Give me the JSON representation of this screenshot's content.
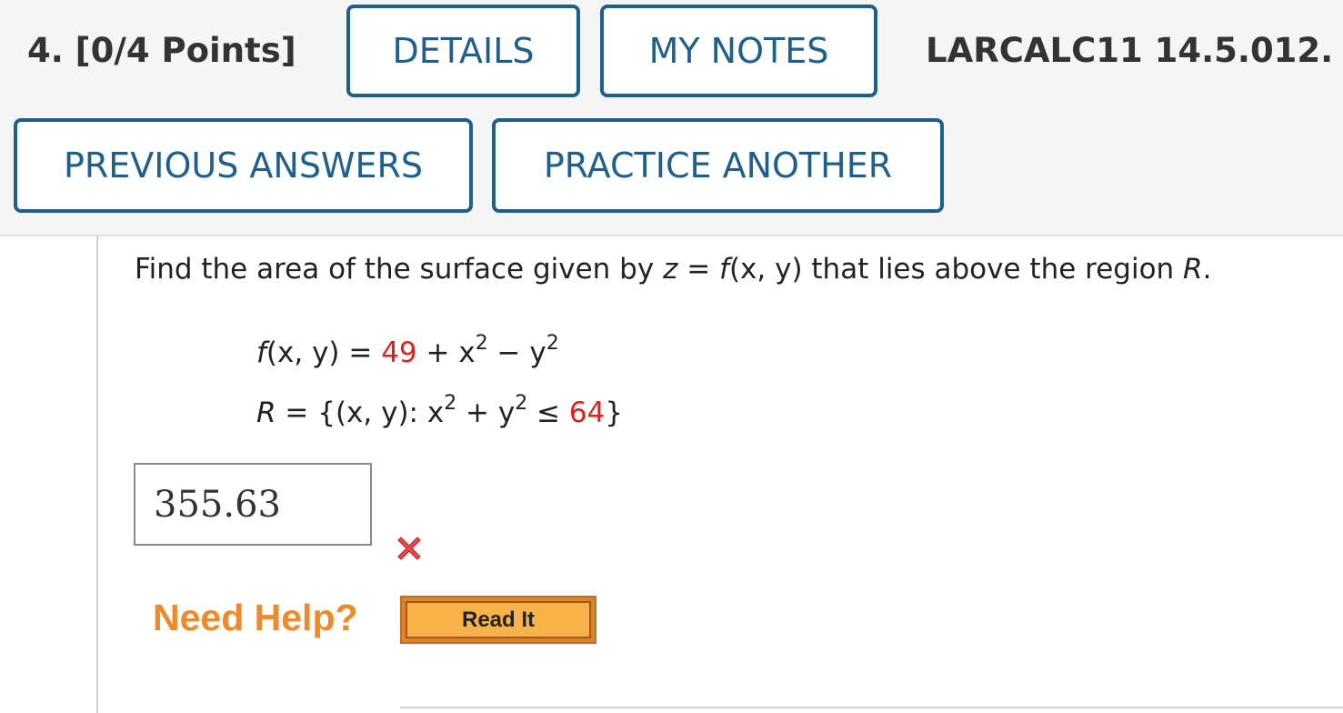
{
  "header": {
    "question_label": "4. [0/4 Points]",
    "details_button": "DETAILS",
    "my_notes_button": "MY NOTES",
    "problem_code": "LARCALC11 14.5.012.",
    "previous_answers_button": "PREVIOUS ANSWERS",
    "practice_another_button": "PRACTICE ANOTHER"
  },
  "problem": {
    "prompt_start": "Find the area of the surface given by ",
    "prompt_z": "z",
    "prompt_eq": " = ",
    "prompt_f": "f",
    "prompt_args": "(x, y)",
    "prompt_mid": " that lies above the region ",
    "prompt_R": "R",
    "prompt_end": ".",
    "function_f": "f",
    "function_lhs": "(x, y) = ",
    "function_constant": "49",
    "function_plus": " + x",
    "function_exp1": "2",
    "function_minus": " − y",
    "function_exp2": "2",
    "region_R": "R",
    "region_lhs": " = {(x, y): x",
    "region_exp1": "2",
    "region_plus": " + y",
    "region_exp2": "2",
    "region_leq": " ≤ ",
    "region_bound": "64",
    "region_close": "}"
  },
  "answer": {
    "value": "355.63",
    "status_icon": "incorrect-x-icon",
    "status_color": "#e0201b"
  },
  "help": {
    "need_help_label": "Need Help?",
    "read_it_button": "Read It"
  },
  "colors": {
    "button_border": "#1f5f8b",
    "highlight_red": "#e0201b",
    "need_help_orange": "#ee8a2a",
    "read_it_fill": "#f8b24a"
  }
}
